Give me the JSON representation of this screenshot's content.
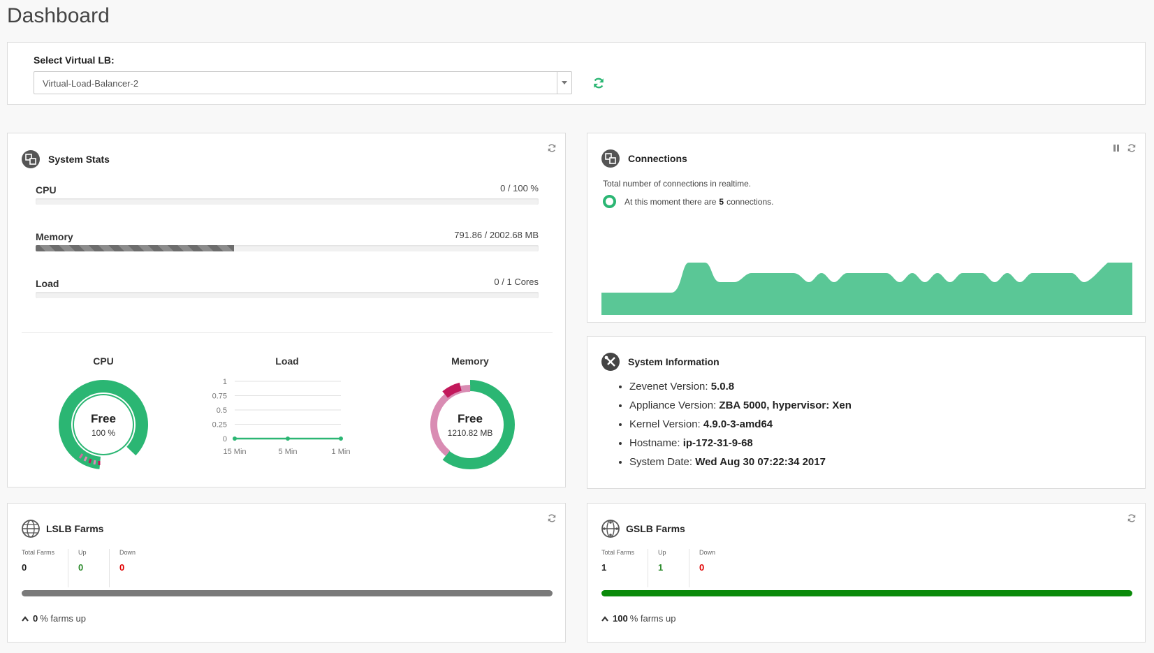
{
  "page": {
    "title": "Dashboard"
  },
  "virtual_lb": {
    "label": "Select Virtual LB:",
    "selected": "Virtual-Load-Balancer-2"
  },
  "system_stats": {
    "title": "System Stats",
    "rows": [
      {
        "label": "CPU",
        "value": "0 / 100 %",
        "fraction": 0
      },
      {
        "label": "Memory",
        "value": "791.86 / 2002.68 MB",
        "fraction": 0.395
      },
      {
        "label": "Load",
        "value": "0 / 1 Cores",
        "fraction": 0
      }
    ],
    "cpu_gauge": {
      "title": "CPU",
      "center_label": "Free",
      "center_value": "100 %"
    },
    "load_chart": {
      "title": "Load",
      "y_ticks": [
        "1",
        "0.75",
        "0.5",
        "0.25",
        "0"
      ],
      "x_ticks": [
        "15 Min",
        "5 Min",
        "1 Min"
      ]
    },
    "memory_gauge": {
      "title": "Memory",
      "center_label": "Free",
      "center_value": "1210.82 MB"
    }
  },
  "connections": {
    "title": "Connections",
    "description": "Total number of connections in realtime.",
    "live_prefix": "At this moment there are",
    "live_count": "5",
    "live_suffix": "connections."
  },
  "system_info": {
    "title": "System Information",
    "items": [
      {
        "label": "Zevenet Version:",
        "value": "5.0.8"
      },
      {
        "label": "Appliance Version:",
        "value": "ZBA 5000, hypervisor: Xen"
      },
      {
        "label": "Kernel Version:",
        "value": "4.9.0-3-amd64"
      },
      {
        "label": "Hostname:",
        "value": "ip-172-31-9-68"
      },
      {
        "label": "System Date:",
        "value": "Wed Aug 30 07:22:34 2017"
      }
    ]
  },
  "lslb": {
    "title": "LSLB Farms",
    "total_label": "Total Farms",
    "total": "0",
    "up_label": "Up",
    "up": "0",
    "down_label": "Down",
    "down": "0",
    "percent": "0",
    "summary_suffix": "% farms up",
    "bar_color": "#7a7a7a"
  },
  "gslb": {
    "title": "GSLB Farms",
    "total_label": "Total Farms",
    "total": "1",
    "up_label": "Up",
    "up": "1",
    "down_label": "Down",
    "down": "0",
    "percent": "100",
    "summary_suffix": "% farms up",
    "bar_color": "#0a8a0a"
  },
  "colors": {
    "accent_green": "#2bb673",
    "area_green": "#5ac796",
    "memory_pink": "#d98cb3",
    "memory_magenta": "#c2185b"
  }
}
